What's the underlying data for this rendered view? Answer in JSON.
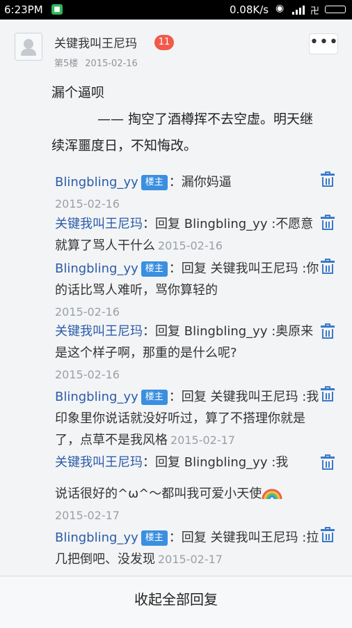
{
  "status_bar": {
    "time": "6:23PM",
    "app_icon": "app-notification-icon",
    "speed": "0.08K/s",
    "wifi_icon": "wifi-icon",
    "signal_icon": "signal-icon",
    "sim_glyph": "卍",
    "battery_icon": "battery-icon"
  },
  "post": {
    "username": "关键我叫王尼玛",
    "badge": "11",
    "floor": "第5楼",
    "date": "2015-02-16",
    "more_label": "•••",
    "content_line1": "漏个逼呗",
    "content_line2": "—— 掏空了酒樽挥不去空虚。明天继",
    "content_line3": "续浑噩度日，不知悔改。"
  },
  "replies": [
    {
      "name": "Blingbling_yy",
      "lz": "楼主",
      "sep": "：",
      "text": "漏你妈逼",
      "date": "2015-02-16"
    },
    {
      "name": "关键我叫王尼玛",
      "sep": "：",
      "text": "回复 Blingbling_yy :不愿意就算了骂人干什么",
      "date": "2015-02-16"
    },
    {
      "name": "Blingbling_yy",
      "lz": "楼主",
      "sep": "：",
      "text": "回复 关键我叫王尼玛 :你的话比骂人难听，骂你算轻的",
      "date": "2015-02-16"
    },
    {
      "name": "关键我叫王尼玛",
      "sep": "：",
      "text": "回复 Blingbling_yy :奥原来是这个样子啊，那重的是什么呢?",
      "date": "2015-02-16"
    },
    {
      "name": "Blingbling_yy",
      "lz": "楼主",
      "sep": "：",
      "text": "回复 关键我叫王尼玛 :我印象里你说话就没好听过，算了不搭理你就是了，点草不是我风格",
      "date": "2015-02-17"
    },
    {
      "name": "关键我叫王尼玛",
      "sep": "：",
      "text": "回复 Blingbling_yy :我",
      "text2": "说话很好的^ω^～都叫我可爱小天使",
      "date": "2015-02-17"
    },
    {
      "name": "Blingbling_yy",
      "lz": "楼主",
      "sep": "：",
      "text": "回复 关键我叫王尼玛 :拉几把倒吧、没发现",
      "date": "2015-02-17"
    }
  ],
  "footer": {
    "collapse_label": "收起全部回复"
  },
  "colors": {
    "name_link": "#2b5ca8",
    "lz_badge": "#3a8fe0",
    "count_badge": "#f15a4a",
    "trash": "#3a79c8"
  }
}
